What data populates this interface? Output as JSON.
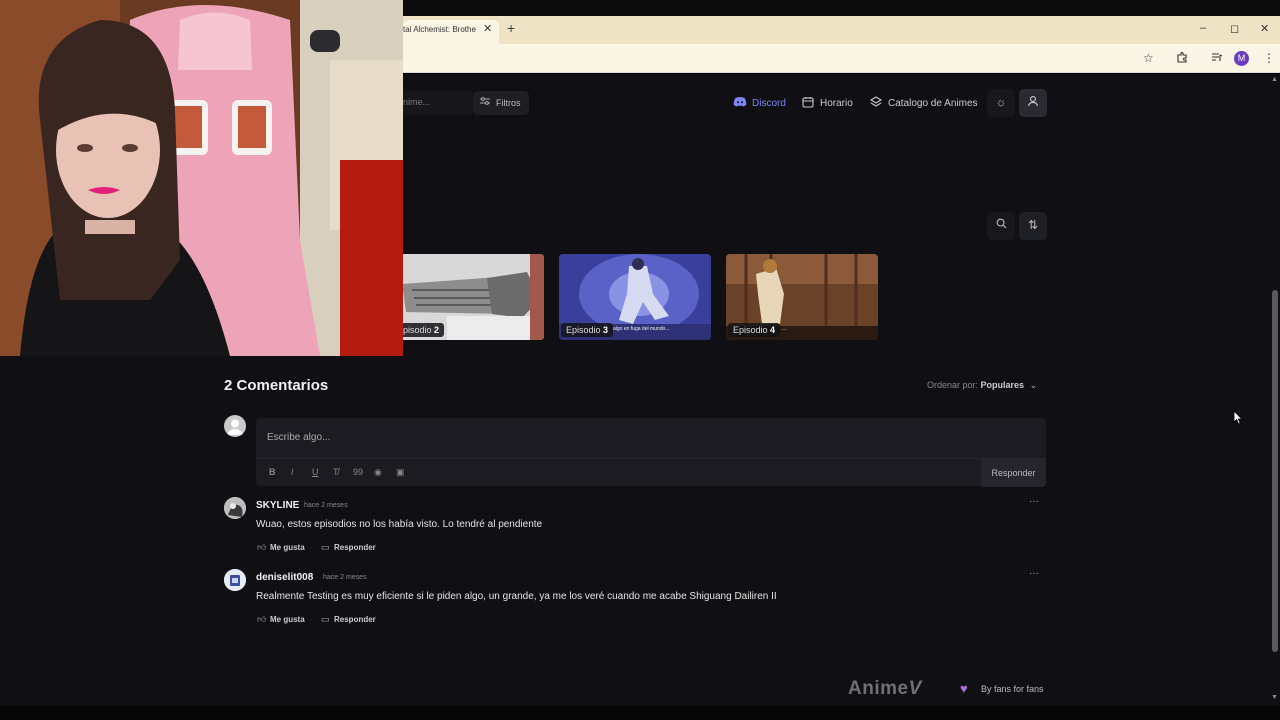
{
  "browser": {
    "tab_title": "tal Alchemist: Brothe",
    "tab_close": "✕",
    "new_tab": "+",
    "profile_initial": "M",
    "window_controls": [
      "–",
      "◻",
      "✕"
    ]
  },
  "header": {
    "search_placeholder": "nime...",
    "filters_label": "Filtros",
    "nav": {
      "discord": "Discord",
      "schedule": "Horario",
      "catalog": "Catalogo de Animes"
    }
  },
  "episodes": [
    {
      "prefix": "pisodio",
      "number": "2"
    },
    {
      "prefix": "Episodio",
      "number": "3"
    },
    {
      "prefix": "Episodio",
      "number": "4"
    }
  ],
  "comments": {
    "title": "2 Comentarios",
    "sort_label": "Ordenar por:",
    "sort_value": "Populares",
    "editor_placeholder": "Escribe algo...",
    "reply_button": "Responder",
    "items": [
      {
        "user": "SKYLINE",
        "time": "hace 2 meses",
        "text": "Wuao, estos episodios no los había visto. Lo tendré al pendiente",
        "like_label": "Me gusta",
        "reply_label": "Responder"
      },
      {
        "user": "deniselit008",
        "time": "hace 2 meses",
        "text": "Realmente Testing es muy eficiente si le piden algo, un grande, ya me los veré cuando me acabe Shiguang Dailiren II",
        "like_label": "Me gusta",
        "reply_label": "Responder"
      }
    ]
  },
  "footer": {
    "logo": "Anime",
    "tagline": "By fans for fans"
  },
  "colors": {
    "page_bg": "#101014",
    "accent_discord": "#7c86f5",
    "heart": "#b06ad6"
  }
}
